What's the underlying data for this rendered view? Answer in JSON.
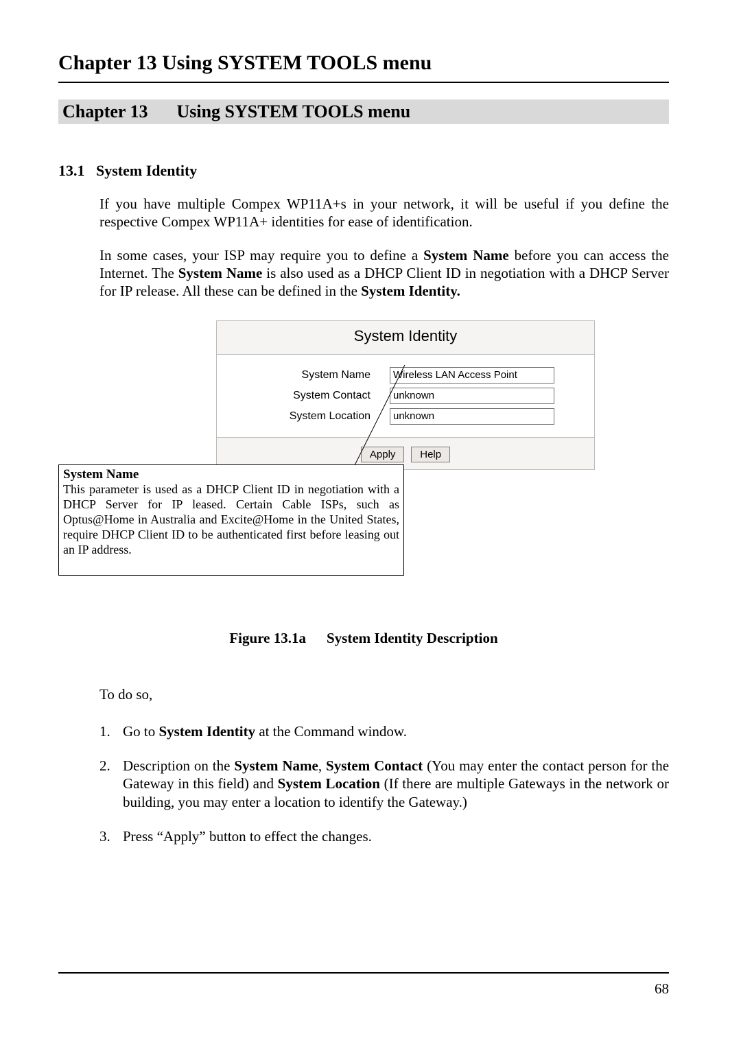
{
  "header": {
    "title": "Chapter 13    Using SYSTEM TOOLS menu"
  },
  "chapter_banner": {
    "label": "Chapter 13",
    "title": "Using SYSTEM TOOLS menu"
  },
  "section": {
    "number": "13.1",
    "title": "System Identity"
  },
  "paragraphs": {
    "p1": "If you have multiple Compex WP11A+s in your network, it will be useful if you define the respective Compex WP11A+ identities for ease of identification.",
    "p2_a": "In some cases, your ISP may require you to define a ",
    "p2_b": "System Name",
    "p2_c": " before you can access the Internet. The ",
    "p2_d": "System Name",
    "p2_e": " is also used as a DHCP Client ID in negotiation with a DHCP Server for IP release. All these can be defined in the ",
    "p2_f": "System Identity."
  },
  "panel": {
    "title": "System Identity",
    "rows": [
      {
        "label": "System Name",
        "value": "Wireless LAN Access Point"
      },
      {
        "label": "System Contact",
        "value": "unknown"
      },
      {
        "label": "System Location",
        "value": "unknown"
      }
    ],
    "buttons": {
      "apply": "Apply",
      "help": "Help"
    }
  },
  "callout": {
    "title": "System Name",
    "text": "This parameter is used as a DHCP Client ID in negotiation with a DHCP Server for IP leased. Certain Cable ISPs, such as Optus@Home in Australia and Excite@Home in the United States, require DHCP Client ID to be authenticated first before leasing out an IP address."
  },
  "figure_caption": {
    "label": "Figure 13.1a",
    "title": "System Identity Description"
  },
  "todo": "To do so,",
  "steps": {
    "s1_a": "Go to ",
    "s1_b": "System Identity",
    "s1_c": " at the Command window.",
    "s2_a": "Description on the ",
    "s2_b": "System Name",
    "s2_c": ", ",
    "s2_d": "System Contact",
    "s2_e": " (You may enter the contact person for the Gateway in this field) and ",
    "s2_f": "System Location",
    "s2_g": " (If there are multiple Gateways in the network or building, you may enter a location to identify the Gateway.)",
    "s3": "Press “Apply” button to effect the changes."
  },
  "page_number": "68"
}
